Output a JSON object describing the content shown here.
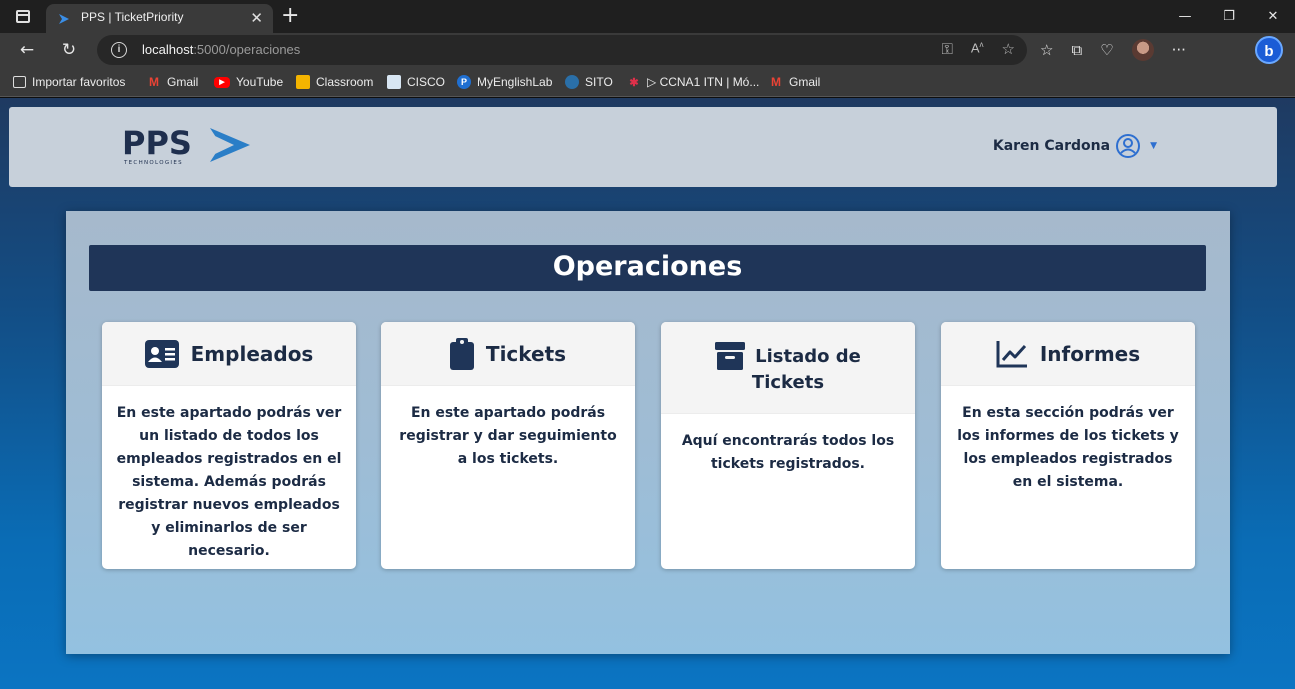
{
  "browser": {
    "tab_title": "PPS | TicketPriority",
    "url_host": "localhost",
    "url_path": ":5000/operaciones",
    "bookmarks": [
      {
        "label": "Importar favoritos"
      },
      {
        "label": "Gmail"
      },
      {
        "label": "YouTube"
      },
      {
        "label": "Classroom"
      },
      {
        "label": "CISCO"
      },
      {
        "label": "MyEnglishLab"
      },
      {
        "label": "SITO"
      },
      {
        "label": "▷ CCNA1 ITN | Mó..."
      },
      {
        "label": "Gmail"
      }
    ]
  },
  "header": {
    "logo_text": "PPS",
    "logo_subtext": "TECHNOLOGIES",
    "user_name": "Karen Cardona"
  },
  "main": {
    "title": "Operaciones",
    "cards": [
      {
        "title": "Empleados",
        "icon": "id-card-icon",
        "description": "En este apartado podrás ver un listado de todos los empleados registrados en el sistema. Además podrás registrar nuevos empleados y eliminarlos de ser necesario."
      },
      {
        "title": "Tickets",
        "icon": "clipboard-icon",
        "description": "En este apartado podrás registrar y dar seguimiento a los tickets."
      },
      {
        "title_line1": "Listado de",
        "title_line2": "Tickets",
        "icon": "archive-icon",
        "description": "Aquí encontrarás todos los tickets registrados."
      },
      {
        "title": "Informes",
        "icon": "chart-line-icon",
        "description": "En esta sección podrás ver los informes de los tickets y los empleados registrados en el sistema."
      }
    ]
  },
  "colors": {
    "accent_dark": "#1f3558",
    "text_dark": "#1c2b44",
    "brand_blue": "#2e6fd0"
  }
}
